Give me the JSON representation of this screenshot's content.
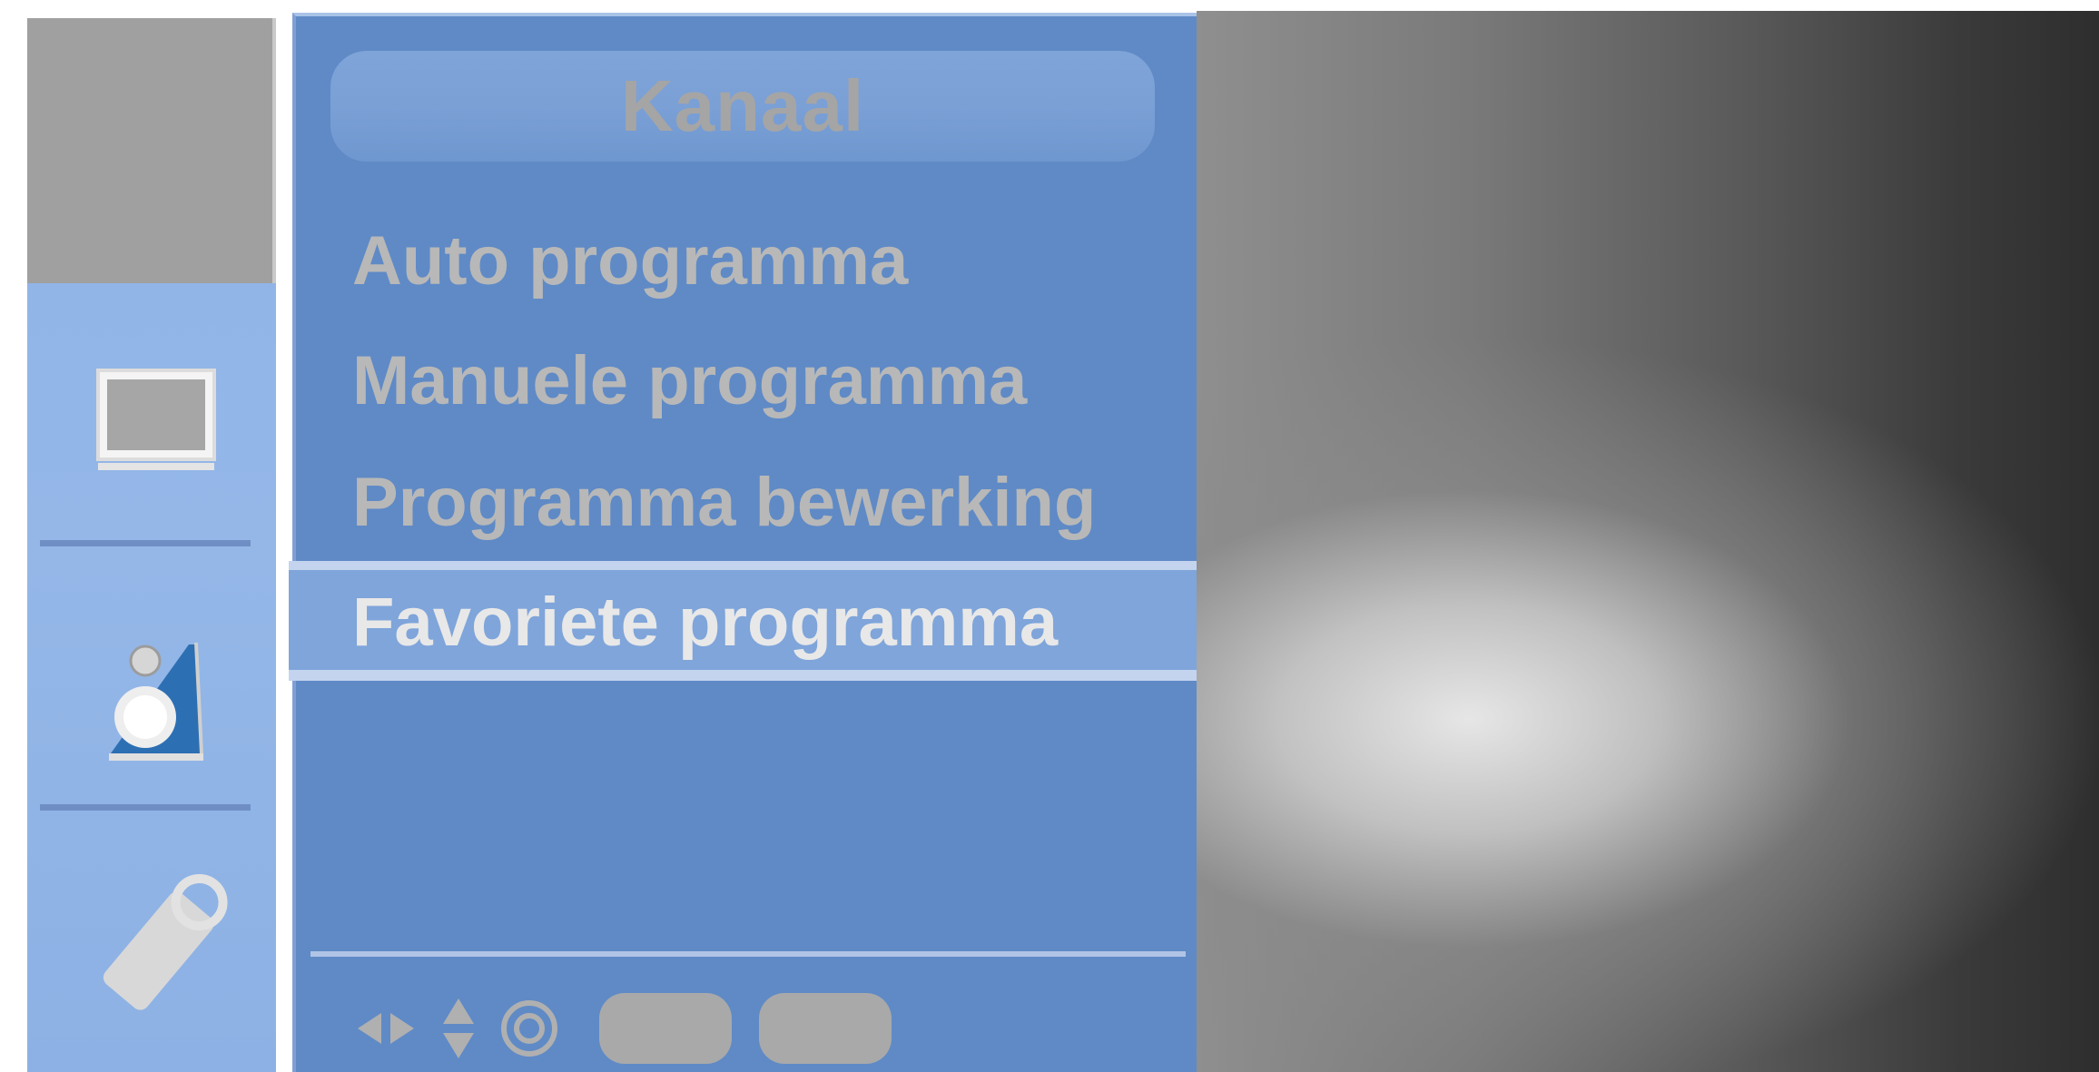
{
  "menu": {
    "title": "Kanaal",
    "items": [
      {
        "label": "Auto  programma",
        "selected": false
      },
      {
        "label": "Manuele  programma",
        "selected": false
      },
      {
        "label": "Programma  bewerking",
        "selected": false
      },
      {
        "label": "Favoriete programma",
        "selected": true
      }
    ]
  },
  "sidebar": {
    "icons": [
      "screen-icon",
      "speaker-icon",
      "tag-icon"
    ]
  },
  "footer": {
    "keys": [
      "left-right-arrows-icon",
      "up-down-arrows-icon",
      "ok-circle-icon",
      "blank-button",
      "blank-button"
    ]
  },
  "colors": {
    "panel": "#5f8ac6",
    "sidebar": "#8fb3e6",
    "text": "#b8b8b8",
    "selected_text": "#e8e8e8"
  }
}
